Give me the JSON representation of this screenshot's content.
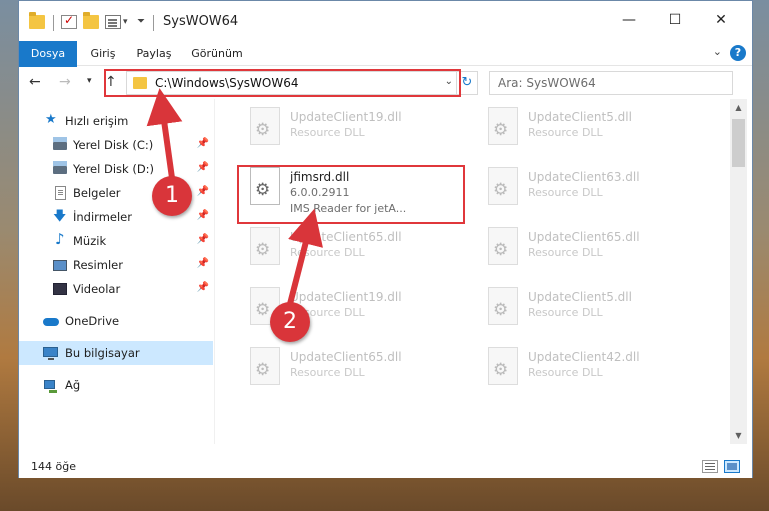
{
  "window": {
    "title": "SysWOW64",
    "controls": {
      "minimize": "—",
      "maximize": "☐",
      "close": "✕"
    }
  },
  "ribbon": {
    "tabs": [
      "Dosya",
      "Giriş",
      "Paylaş",
      "Görünüm"
    ],
    "help": "?"
  },
  "navbar": {
    "address": "C:\\Windows\\SysWOW64",
    "search_placeholder": "Ara: SysWOW64"
  },
  "sidebar": {
    "items": [
      {
        "label": "Hızlı erişim",
        "icon": "star-icon"
      },
      {
        "label": "Yerel Disk (C:)",
        "icon": "disk-icon",
        "pinned": true
      },
      {
        "label": "Yerel Disk (D:)",
        "icon": "disk-icon",
        "pinned": true
      },
      {
        "label": "Belgeler",
        "icon": "document-icon",
        "pinned": true
      },
      {
        "label": "İndirmeler",
        "icon": "download-icon",
        "pinned": true
      },
      {
        "label": "Müzik",
        "icon": "music-icon",
        "pinned": true
      },
      {
        "label": "Resimler",
        "icon": "pictures-icon",
        "pinned": true
      },
      {
        "label": "Videolar",
        "icon": "video-icon",
        "pinned": true
      },
      {
        "label": "OneDrive",
        "icon": "cloud-icon"
      },
      {
        "label": "Bu bilgisayar",
        "icon": "computer-icon",
        "selected": true
      },
      {
        "label": "Ağ",
        "icon": "network-icon"
      }
    ]
  },
  "files": [
    {
      "name": "UpdateClient19.dll",
      "type": "Resource DLL"
    },
    {
      "name": "UpdateClient5.dll",
      "type": "Resource DLL"
    },
    {
      "name": "jfimsrd.dll",
      "version": "6.0.0.2911",
      "desc": "IMS Reader for jetA...",
      "active": true
    },
    {
      "name": "UpdateClient63.dll",
      "type": "Resource DLL"
    },
    {
      "name": "UpdateClient65.dll",
      "type": "Resource DLL"
    },
    {
      "name": "UpdateClient65.dll",
      "type": "Resource DLL"
    },
    {
      "name": "UpdateClient19.dll",
      "type": "Resource DLL"
    },
    {
      "name": "UpdateClient5.dll",
      "type": "Resource DLL"
    },
    {
      "name": "UpdateClient65.dll",
      "type": "Resource DLL"
    },
    {
      "name": "UpdateClient42.dll",
      "type": "Resource DLL"
    }
  ],
  "status": {
    "count": "144 öğe"
  },
  "callouts": {
    "one": "1",
    "two": "2"
  },
  "colors": {
    "accent": "#1979ca",
    "highlight": "#e0373b",
    "selected": "#cce8ff"
  }
}
